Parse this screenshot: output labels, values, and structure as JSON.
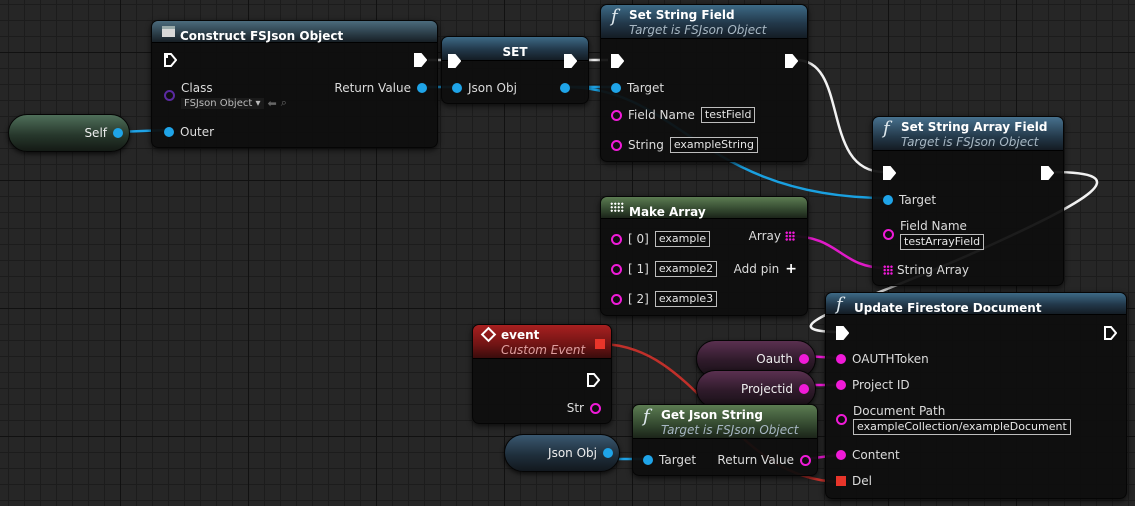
{
  "nodes": {
    "construct": {
      "title": "Construct FSJson Object",
      "class_label": "Class",
      "class_value": "FSJson Object",
      "return_label": "Return Value",
      "outer_label": "Outer"
    },
    "set": {
      "title": "SET",
      "json_obj_label": "Json Obj"
    },
    "set_string_field": {
      "title": "Set String Field",
      "subtitle": "Target is FSJson Object",
      "target_label": "Target",
      "field_name_label": "Field Name",
      "field_name_value": "testField",
      "string_label": "String",
      "string_value": "exampleString"
    },
    "set_string_array_field": {
      "title": "Set String Array Field",
      "subtitle": "Target is FSJson Object",
      "target_label": "Target",
      "field_name_label": "Field Name",
      "field_name_value": "testArrayField",
      "string_array_label": "String Array"
    },
    "make_array": {
      "title": "Make Array",
      "items": [
        {
          "label": "[ 0]",
          "value": "example"
        },
        {
          "label": "[ 1]",
          "value": "example2"
        },
        {
          "label": "[ 2]",
          "value": "example3"
        }
      ],
      "array_label": "Array",
      "add_pin_label": "Add pin"
    },
    "update_firestore": {
      "title": "Update Firestore Document",
      "oauth_label": "OAUTHToken",
      "project_label": "Project ID",
      "docpath_label": "Document Path",
      "docpath_value": "exampleCollection/exampleDocument",
      "content_label": "Content",
      "del_label": "Del"
    },
    "event": {
      "title": "event",
      "subtitle": "Custom Event",
      "str_label": "Str"
    },
    "get_json_string": {
      "title": "Get Json String",
      "subtitle": "Target is FSJson Object",
      "target_label": "Target",
      "return_label": "Return Value"
    }
  },
  "variables": {
    "self": "Self",
    "oauth": "Oauth",
    "projectid": "Projectid",
    "json_obj": "Json Obj"
  },
  "colors": {
    "exec": "#ffffff",
    "object_pin": "#1fa4e8",
    "string_pin": "#f01ad8",
    "class_pin": "#5a2aa0",
    "delegate_pin": "#e8352a"
  }
}
